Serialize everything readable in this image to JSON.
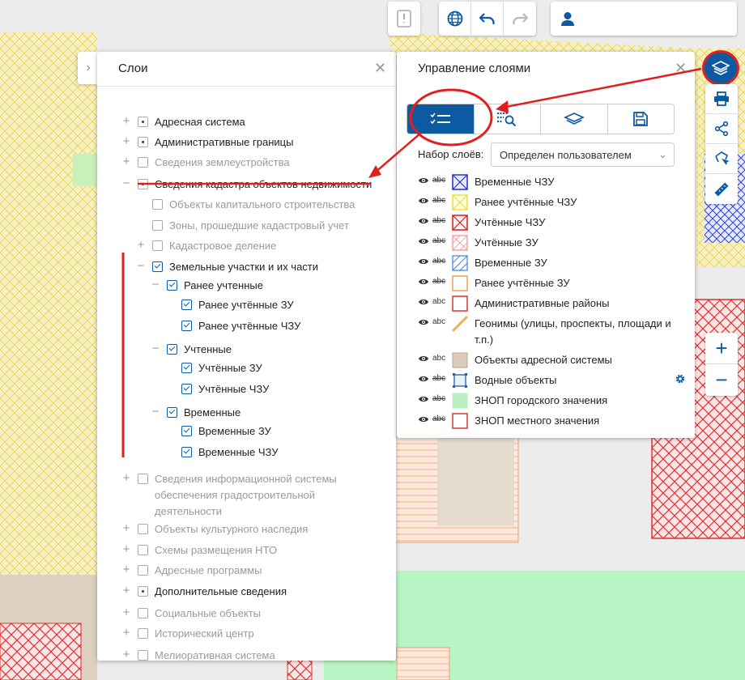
{
  "layers_panel": {
    "title": "Слои",
    "tree": [
      {
        "label": "Адресная система",
        "state": "partial",
        "level": 0,
        "expander": "+"
      },
      {
        "label": "Административные границы",
        "state": "partial",
        "level": 0,
        "expander": "+"
      },
      {
        "label": "Сведения землеустройства",
        "state": "off",
        "level": 0,
        "expander": "+"
      },
      {
        "label": "Сведения кадастра объектов недвижимости",
        "state": "partial",
        "level": 0,
        "expander": "−"
      },
      {
        "label": "Объекты капитального строительства",
        "state": "off",
        "level": 1,
        "expander": ""
      },
      {
        "label": "Зоны, прошедшие кадастровый учет",
        "state": "off",
        "level": 1,
        "expander": ""
      },
      {
        "label": "Кадастровое деление",
        "state": "off",
        "level": 1,
        "expander": "+"
      },
      {
        "label": "Земельные участки и их части",
        "state": "checked",
        "level": 1,
        "expander": "−"
      },
      {
        "label": "Ранее учтенные",
        "state": "checked",
        "level": 2,
        "expander": "−"
      },
      {
        "label": "Ранее учтённые ЗУ",
        "state": "checked",
        "level": 3,
        "expander": ""
      },
      {
        "label": "Ранее учтённые ЧЗУ",
        "state": "checked",
        "level": 3,
        "expander": ""
      },
      {
        "label": "Учтенные",
        "state": "checked",
        "level": 2,
        "expander": "−"
      },
      {
        "label": "Учтённые ЗУ",
        "state": "checked",
        "level": 3,
        "expander": ""
      },
      {
        "label": "Учтённые ЧЗУ",
        "state": "checked",
        "level": 3,
        "expander": ""
      },
      {
        "label": "Временные",
        "state": "checked",
        "level": 2,
        "expander": "−"
      },
      {
        "label": "Временные ЗУ",
        "state": "checked",
        "level": 3,
        "expander": ""
      },
      {
        "label": "Временные ЧЗУ",
        "state": "checked",
        "level": 3,
        "expander": ""
      },
      {
        "label": "Сведения информационной системы",
        "label2": "обеспечения градостроительной",
        "label3": "деятельности",
        "state": "off",
        "level": 0,
        "expander": "+"
      },
      {
        "label": "Объекты культурного наследия",
        "state": "off",
        "level": 0,
        "expander": "+"
      },
      {
        "label": "Схемы размещения НТО",
        "state": "off",
        "level": 0,
        "expander": "+"
      },
      {
        "label": "Адресные программы",
        "state": "off",
        "level": 0,
        "expander": "+"
      },
      {
        "label": "Дополнительные сведения",
        "state": "partial",
        "level": 0,
        "expander": "+"
      },
      {
        "label": "Социальные объекты",
        "state": "off",
        "level": 0,
        "expander": "+"
      },
      {
        "label": "Исторический центр",
        "state": "off",
        "level": 0,
        "expander": "+"
      },
      {
        "label": "Мелиоративная система",
        "state": "off",
        "level": 0,
        "expander": "+"
      }
    ]
  },
  "mgmt_panel": {
    "title": "Управление слоями",
    "preset_label": "Набор слоёв:",
    "preset_value": "Определен пользователем",
    "legend": [
      {
        "label": "Временные ЧЗУ",
        "abc_struck": true,
        "swatch": "blue-cross"
      },
      {
        "label": "Ранее учтённые ЧЗУ",
        "abc_struck": true,
        "swatch": "yellow-cross"
      },
      {
        "label": "Учтённые ЧЗУ",
        "abc_struck": true,
        "swatch": "red-cross"
      },
      {
        "label": "Учтённые ЗУ",
        "abc_struck": true,
        "swatch": "pink-cross"
      },
      {
        "label": "Временные ЗУ",
        "abc_struck": true,
        "swatch": "blue-hatch"
      },
      {
        "label": "Ранее учтённые ЗУ",
        "abc_struck": true,
        "swatch": "orange-lines"
      },
      {
        "label": "Административные районы",
        "abc_struck": false,
        "swatch": "red-outline"
      },
      {
        "label": "Геонимы (улицы, проспекты, площади и",
        "label2": "т.п.)",
        "abc_struck": false,
        "swatch": "orange-diagonal"
      },
      {
        "label": "Объекты адресной системы",
        "abc_struck": false,
        "swatch": "tan-fill"
      },
      {
        "label": "Водные объекты",
        "abc_struck": true,
        "swatch": "water"
      },
      {
        "label": "ЗНОП городского значения",
        "abc_struck": true,
        "swatch": "green-fill"
      },
      {
        "label": "ЗНОП местного значения",
        "abc_struck": true,
        "swatch": "red-outline"
      }
    ],
    "abc_text": "abc"
  },
  "colors": {
    "accent": "#0b5aa2",
    "annotation": "#e02020",
    "hatch_yellow": "#e8d85a",
    "hatch_red": "#e03030",
    "green_zone": "#b8f5c4"
  },
  "icons": [
    "document-icon",
    "globe-icon",
    "undo-icon",
    "redo-icon",
    "user-icon",
    "layers-icon",
    "print-icon",
    "share-icon",
    "select-area-icon",
    "ruler-icon",
    "zoom-in-icon",
    "zoom-out-icon",
    "settings-gear-icon",
    "eye-icon"
  ]
}
